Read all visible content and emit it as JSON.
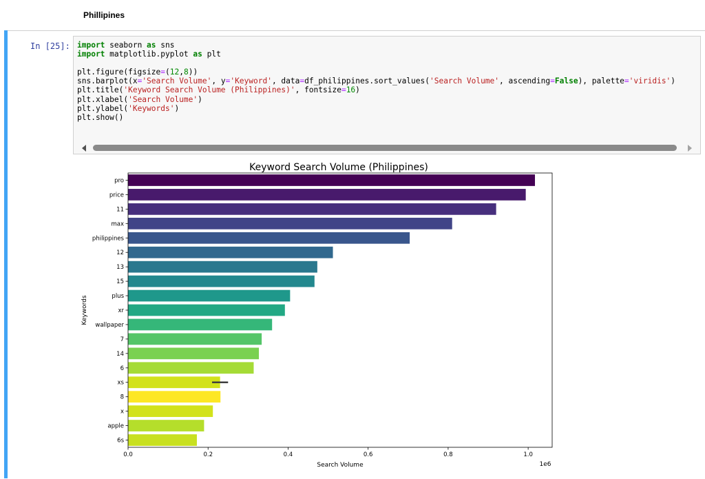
{
  "markdown": {
    "heading": "Phillipines"
  },
  "cell": {
    "prompt": "In [25]:",
    "code_lines": [
      [
        {
          "t": "import",
          "c": "kw"
        },
        {
          "t": " seaborn ",
          "c": ""
        },
        {
          "t": "as",
          "c": "kw"
        },
        {
          "t": " sns",
          "c": ""
        }
      ],
      [
        {
          "t": "import",
          "c": "kw"
        },
        {
          "t": " matplotlib.pyplot ",
          "c": ""
        },
        {
          "t": "as",
          "c": "kw"
        },
        {
          "t": " plt",
          "c": ""
        }
      ],
      [],
      [
        {
          "t": "plt.figure(figsize",
          "c": ""
        },
        {
          "t": "=",
          "c": "op"
        },
        {
          "t": "(",
          "c": ""
        },
        {
          "t": "12",
          "c": "nm"
        },
        {
          "t": ",",
          "c": ""
        },
        {
          "t": "8",
          "c": "nm"
        },
        {
          "t": "))",
          "c": ""
        }
      ],
      [
        {
          "t": "sns.barplot(x",
          "c": ""
        },
        {
          "t": "=",
          "c": "op"
        },
        {
          "t": "'Search Volume'",
          "c": "st"
        },
        {
          "t": ", y",
          "c": ""
        },
        {
          "t": "=",
          "c": "op"
        },
        {
          "t": "'Keyword'",
          "c": "st"
        },
        {
          "t": ", data",
          "c": ""
        },
        {
          "t": "=",
          "c": "op"
        },
        {
          "t": "df_philippines.sort_values(",
          "c": ""
        },
        {
          "t": "'Search Volume'",
          "c": "st"
        },
        {
          "t": ", ascending",
          "c": ""
        },
        {
          "t": "=",
          "c": "op"
        },
        {
          "t": "False",
          "c": "kw"
        },
        {
          "t": "), palette",
          "c": ""
        },
        {
          "t": "=",
          "c": "op"
        },
        {
          "t": "'viridis'",
          "c": "st"
        },
        {
          "t": ")",
          "c": ""
        }
      ],
      [
        {
          "t": "plt.title(",
          "c": ""
        },
        {
          "t": "'Keyword Search Volume (Philippines)'",
          "c": "st"
        },
        {
          "t": ", fontsize",
          "c": ""
        },
        {
          "t": "=",
          "c": "op"
        },
        {
          "t": "16",
          "c": "nm"
        },
        {
          "t": ")",
          "c": ""
        }
      ],
      [
        {
          "t": "plt.xlabel(",
          "c": ""
        },
        {
          "t": "'Search Volume'",
          "c": "st"
        },
        {
          "t": ")",
          "c": ""
        }
      ],
      [
        {
          "t": "plt.ylabel(",
          "c": ""
        },
        {
          "t": "'Keywords'",
          "c": "st"
        },
        {
          "t": ")",
          "c": ""
        }
      ],
      [
        {
          "t": "plt.show()",
          "c": ""
        }
      ]
    ]
  },
  "chart_data": {
    "type": "bar",
    "orientation": "horizontal",
    "title": "Keyword Search Volume (Philippines)",
    "xlabel": "Search Volume",
    "ylabel": "Keywords",
    "x_offset_label": "1e6",
    "xlim": [
      0,
      1.06
    ],
    "xticks": [
      0.0,
      0.2,
      0.4,
      0.6,
      0.8,
      1.0
    ],
    "xtick_labels": [
      "0.0",
      "0.2",
      "0.4",
      "0.6",
      "0.8",
      "1.0"
    ],
    "palette": "viridis",
    "categories": [
      "pro",
      "price",
      "11",
      "max",
      "philippines",
      "12",
      "13",
      "15",
      "plus",
      "xr",
      "wallpaper",
      "7",
      "14",
      "6",
      "xs",
      "8",
      "x",
      "apple",
      "6s"
    ],
    "values": [
      1.017,
      0.994,
      0.92,
      0.81,
      0.704,
      0.512,
      0.473,
      0.466,
      0.405,
      0.392,
      0.36,
      0.334,
      0.327,
      0.314,
      0.23,
      0.231,
      0.212,
      0.19,
      0.172
    ],
    "error_bars": [
      null,
      null,
      null,
      null,
      null,
      null,
      null,
      null,
      null,
      null,
      null,
      null,
      null,
      null,
      [
        0.21,
        0.25
      ],
      null,
      null,
      null,
      null
    ],
    "colors": [
      "#440154",
      "#481a6c",
      "#472f7d",
      "#414487",
      "#39568c",
      "#31688e",
      "#2a788e",
      "#23888e",
      "#1f988b",
      "#22a884",
      "#35b779",
      "#54c568",
      "#7ad151",
      "#a5db36",
      "#d2e21b",
      "#fde725",
      "#d2e21b",
      "#b5de2b",
      "#c8e020"
    ]
  }
}
